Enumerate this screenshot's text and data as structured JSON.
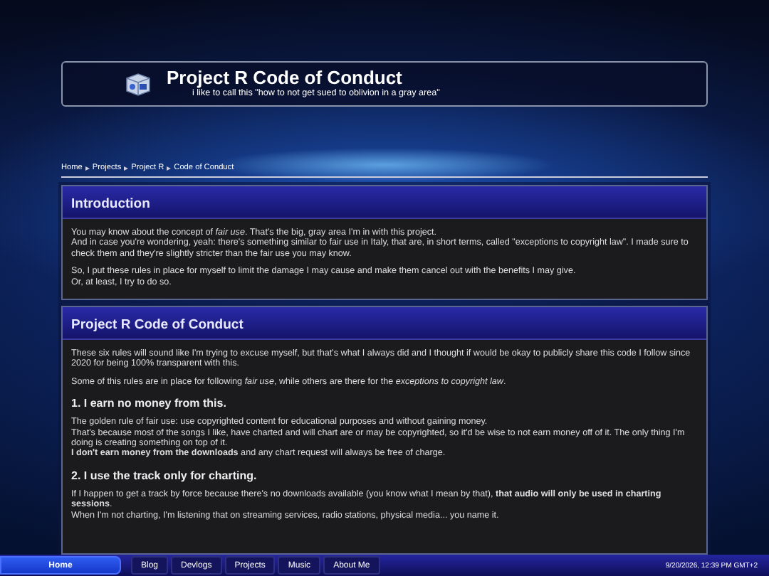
{
  "header": {
    "title": "Project R Code of Conduct",
    "subtitle": "i like to call this \"how to not get sued to oblivion in a gray area\""
  },
  "breadcrumb": [
    "Home",
    "Projects",
    "Project R",
    "Code of Conduct"
  ],
  "sections": [
    {
      "title": "Introduction",
      "blocks": [
        {
          "kind": "p",
          "lines": [
            "You may know about the concept of *fair use*. That's the big, gray area I'm in with this project.",
            "And in case you're wondering, yeah: there's something similar to fair use in Italy, that are, in short terms, called \"exceptions to copyright law\". I made sure to check them and they're slightly stricter than the fair use you may know."
          ]
        },
        {
          "kind": "p",
          "lines": [
            "So, I put these rules in place for myself to limit the damage I may cause and make them cancel out with the benefits I may give.",
            "Or, at least, I try to do so."
          ]
        }
      ]
    },
    {
      "title": "Project R Code of Conduct",
      "blocks": [
        {
          "kind": "p",
          "lines": [
            "These six rules will sound like I'm trying to excuse myself, but that's what I always did and I thought if would be okay to publicly share this code I follow since 2020 for being 100% transparent with this."
          ]
        },
        {
          "kind": "p",
          "lines": [
            "Some of this rules are in place for following *fair use*, while others are there for the *exceptions to copyright law*."
          ]
        },
        {
          "kind": "h",
          "lines": [
            "1. I earn no money from this."
          ]
        },
        {
          "kind": "p",
          "lines": [
            "The golden rule of fair use: use copyrighted content for educational purposes and without gaining money.",
            "That's because most of the songs I like, have charted and will chart are or may be copyrighted, so it'd be wise to not earn money off of it. The only thing I'm doing is creating something on top of it.",
            "**I don't earn money from the downloads** and any chart request will always be free of charge."
          ]
        },
        {
          "kind": "h",
          "lines": [
            "2. I use the track only for charting."
          ]
        },
        {
          "kind": "p",
          "lines": [
            "If I happen to get a track by force because there's no downloads available (you know what I mean by that), **that audio will only be used in charting sessions**.",
            "When I'm not charting, I'm listening that on streaming services, radio stations, physical media... you name it."
          ]
        }
      ]
    }
  ],
  "taskbar": {
    "tabs": [
      {
        "label": "Home",
        "selected": true
      },
      {
        "label": "Blog",
        "selected": false
      },
      {
        "label": "Devlogs",
        "selected": false
      },
      {
        "label": "Projects",
        "selected": false
      },
      {
        "label": "Music",
        "selected": false
      },
      {
        "label": "About Me",
        "selected": false
      }
    ],
    "clock": "9/20/2026, 12:39 PM GMT+2"
  }
}
